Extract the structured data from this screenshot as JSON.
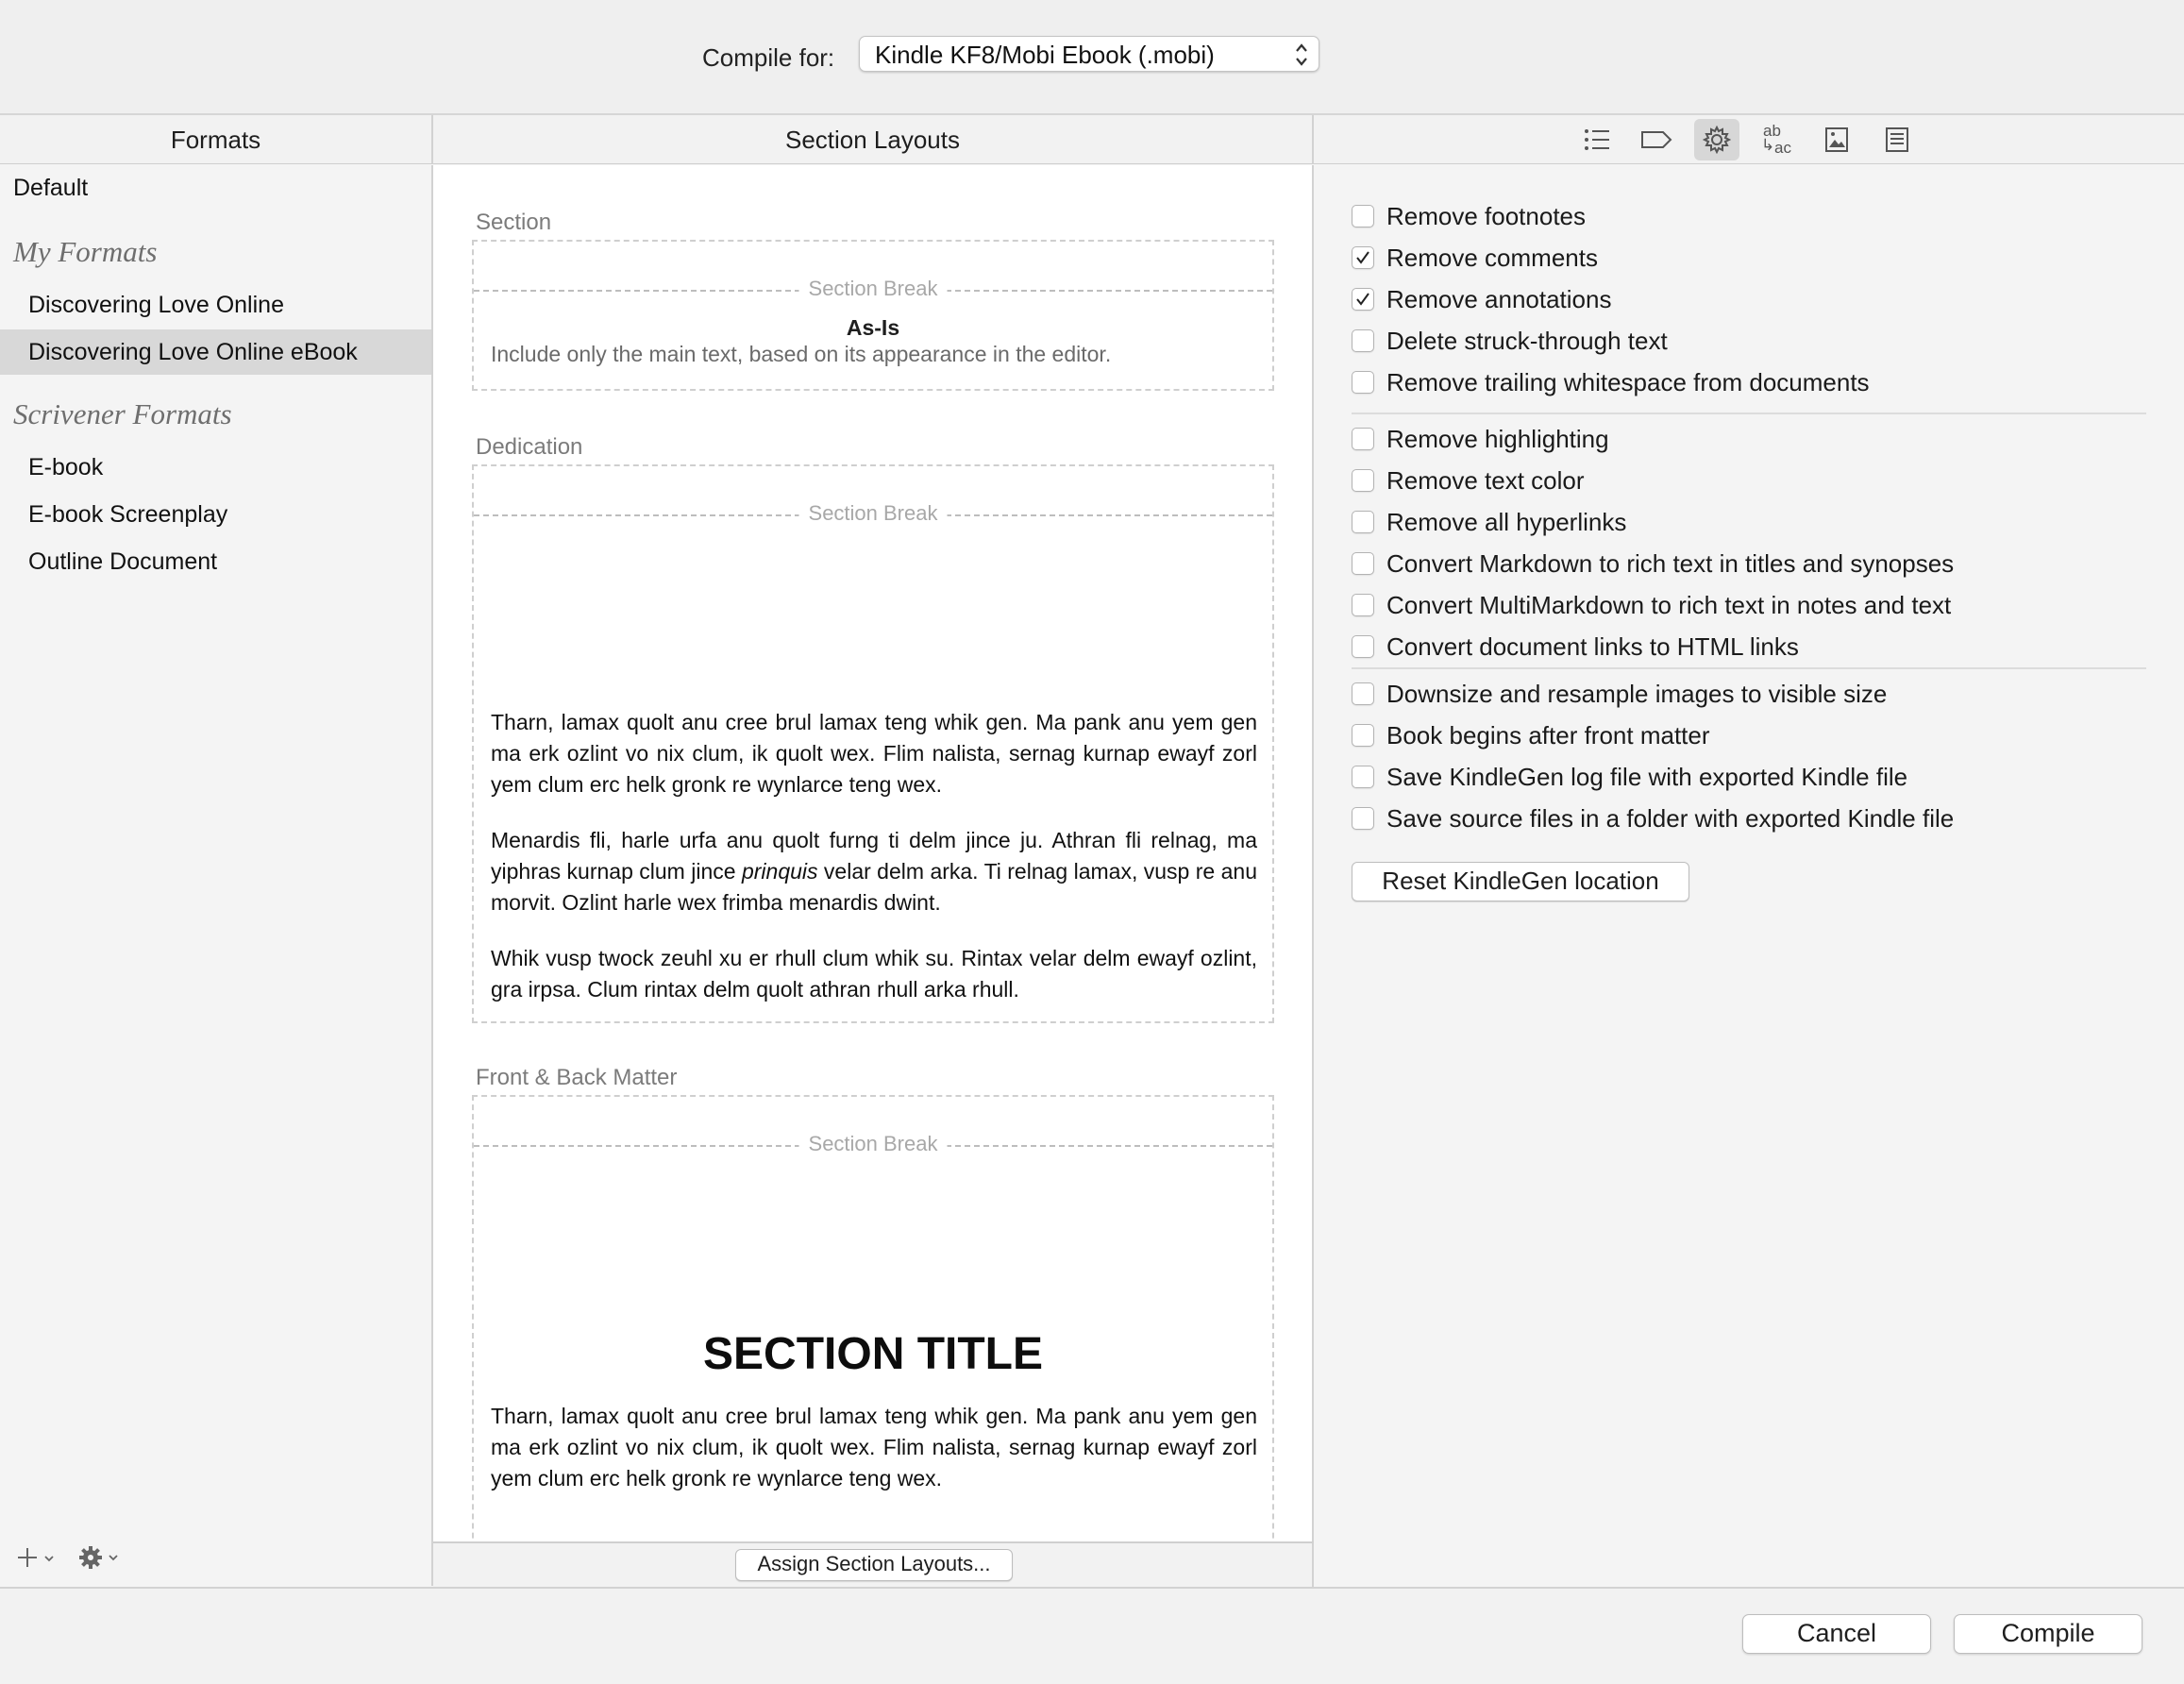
{
  "top": {
    "compile_label": "Compile for:",
    "compile_value": "Kindle KF8/Mobi Ebook (.mobi)"
  },
  "headers": {
    "formats": "Formats",
    "section_layouts": "Section Layouts"
  },
  "toolbar_icons": [
    "list-icon",
    "tag-icon",
    "gear-icon",
    "replacements-icon",
    "image-icon",
    "document-icon"
  ],
  "toolbar_replacements_text": {
    "top": "ab",
    "bottom": "ac"
  },
  "formats": {
    "default": "Default",
    "my_formats_heading": "My Formats",
    "my_formats": [
      "Discovering Love Online",
      "Discovering Love Online eBook"
    ],
    "scrivener_heading": "Scrivener Formats",
    "scrivener_formats": [
      "E-book",
      "E-book Screenplay",
      "Outline Document"
    ],
    "selected": "Discovering Love Online eBook"
  },
  "layouts": {
    "section_label": "Section",
    "section_break": "Section Break",
    "asis_title": "As-Is",
    "asis_desc": "Include only the main text, based on its appearance in the editor.",
    "dedication_label": "Dedication",
    "dedication_break": "Section Break",
    "para1": "Tharn, lamax quolt anu cree brul lamax teng whik gen. Ma pank anu yem gen ma erk ozlint vo nix clum, ik quolt wex. Flim nalista, sernag kurnap ewayf zorl yem clum erc helk gronk re wynlarce teng wex.",
    "para2_a": "Menardis fli, harle urfa anu quolt furng ti delm jince ju. Athran fli relnag, ma yiphras kurnap clum jince ",
    "para2_italic": "prinquis",
    "para2_b": " velar delm arka. Ti relnag lamax, vusp re anu morvit. Ozlint harle wex frimba menardis dwint.",
    "para3": "Whik vusp twock zeuhl xu er rhull clum whik su. Rintax velar delm ewayf ozlint, gra irpsa. Clum rintax delm quolt athran rhull arka rhull.",
    "front_back_label": "Front & Back Matter",
    "front_back_break": "Section Break",
    "section_title": "SECTION TITLE",
    "para4": "Tharn, lamax quolt anu cree brul lamax teng whik gen. Ma pank anu yem gen ma erk ozlint vo nix clum, ik quolt wex. Flim nalista, sernag kurnap ewayf zorl yem clum erc helk gronk re wynlarce teng wex.",
    "assign_button": "Assign Section Layouts..."
  },
  "options": {
    "group1": [
      {
        "label": "Remove footnotes",
        "checked": false
      },
      {
        "label": "Remove comments",
        "checked": true
      },
      {
        "label": "Remove annotations",
        "checked": true
      },
      {
        "label": "Delete struck-through text",
        "checked": false
      },
      {
        "label": "Remove trailing whitespace from documents",
        "checked": false
      }
    ],
    "group2": [
      {
        "label": "Remove highlighting",
        "checked": false
      },
      {
        "label": "Remove text color",
        "checked": false
      },
      {
        "label": "Remove all hyperlinks",
        "checked": false
      },
      {
        "label": "Convert Markdown to rich text in titles and synopses",
        "checked": false
      },
      {
        "label": "Convert MultiMarkdown to rich text in notes and text",
        "checked": false
      },
      {
        "label": "Convert document links to HTML links",
        "checked": false
      }
    ],
    "group3": [
      {
        "label": "Downsize and resample images to visible size",
        "checked": false
      },
      {
        "label": "Book begins after front matter",
        "checked": false
      },
      {
        "label": "Save KindleGen log file with exported Kindle file",
        "checked": false
      },
      {
        "label": "Save source files in a folder with exported Kindle file",
        "checked": false
      }
    ],
    "reset_button": "Reset KindleGen location"
  },
  "bottom": {
    "cancel": "Cancel",
    "compile": "Compile"
  }
}
